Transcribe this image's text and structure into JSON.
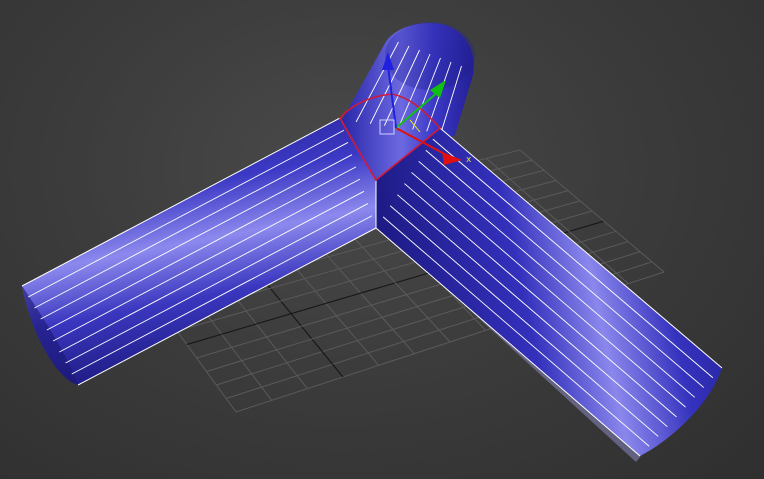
{
  "viewport": {
    "kind": "3D perspective viewport",
    "colors": {
      "background": "#3a3a3a",
      "grid_line": "#5a5a5a",
      "grid_axis": "#141414",
      "object_fill": "#2d2aa6",
      "object_highlight": "#8f8cf0",
      "wire_edge": "#ffffff",
      "selection_seam": "#d01a3a",
      "axis_x": "#e01010",
      "axis_y": "#10c010",
      "axis_z": "#2020e0"
    }
  },
  "scene_object": {
    "type": "three-way pipe junction",
    "branches": [
      "left-branch",
      "right-branch",
      "top-branch"
    ],
    "selected_element": "junction seam"
  },
  "gizmo": {
    "type": "move transform gizmo",
    "axes": [
      {
        "axis": "x",
        "label": "x",
        "icon": "red-cone-arrow-icon"
      },
      {
        "axis": "y",
        "label": "",
        "icon": "green-cone-arrow-icon"
      },
      {
        "axis": "z",
        "label": "",
        "icon": "blue-cone-arrow-icon"
      }
    ],
    "center_icon": "square-pivot-icon"
  }
}
